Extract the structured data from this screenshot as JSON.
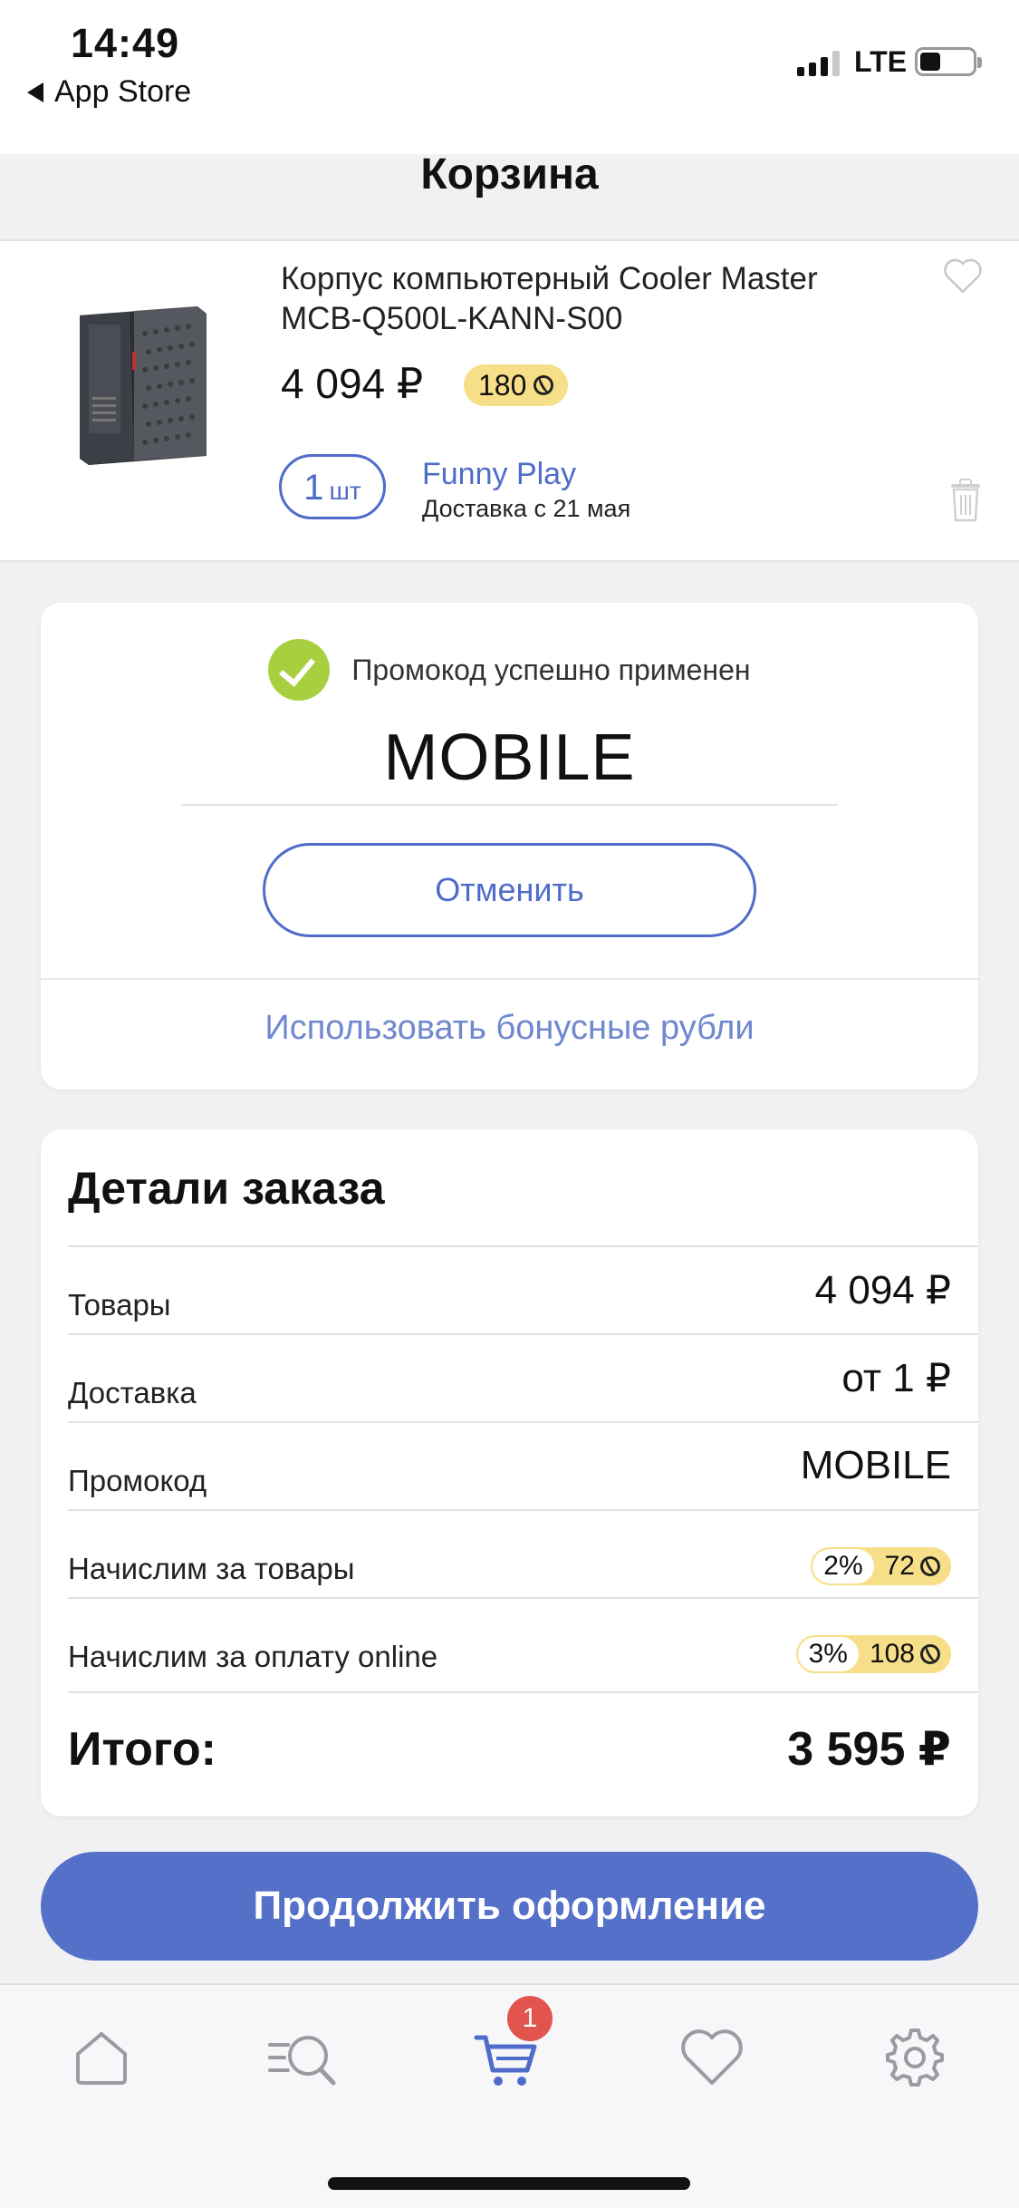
{
  "status": {
    "time": "14:49",
    "back_label": "App Store",
    "network": "LTE"
  },
  "header": {
    "title": "Корзина"
  },
  "product": {
    "name": "Корпус компьютерный Cooler Master MCB-Q500L-KANN-S00",
    "price": "4 094 ₽",
    "bonus": "180",
    "qty_number": "1",
    "qty_unit": "шт",
    "seller": "Funny Play",
    "delivery": "Доставка с 21 мая"
  },
  "promo": {
    "status": "Промокод успешно применен",
    "code": "MOBILE",
    "cancel": "Отменить",
    "use_bonus": "Использовать бонусные рубли"
  },
  "details": {
    "title": "Детали заказа",
    "goods_label": "Товары",
    "goods_value": "4 094 ₽",
    "delivery_label": "Доставка",
    "delivery_value": "от 1 ₽",
    "promo_label": "Промокод",
    "promo_value": "MOBILE",
    "accrue_goods_label": "Начислим за товары",
    "accrue_goods_pct": "2%",
    "accrue_goods_amt": "72",
    "accrue_online_label": "Начислим за оплату online",
    "accrue_online_pct": "3%",
    "accrue_online_amt": "108",
    "total_label": "Итого:",
    "total_value": "3 595 ₽"
  },
  "checkout": {
    "label": "Продолжить оформление"
  },
  "tabbar": {
    "items": [
      "home-icon",
      "catalog-search-icon",
      "cart-icon",
      "heart-icon",
      "settings-icon"
    ],
    "cart_badge": "1"
  },
  "colors": {
    "accent": "#5470c8",
    "link": "#4f6cc9",
    "bonus": "#f7df8a",
    "success": "#a8cf3f",
    "badge": "#e2544e"
  }
}
